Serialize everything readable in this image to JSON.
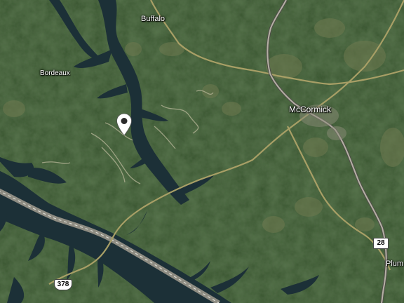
{
  "map": {
    "view": "satellite",
    "places": {
      "buffalo": "Buffalo",
      "bordeaux": "Bordeaux",
      "mccormick": "McCormick",
      "plum": "Plum"
    },
    "route_shields": {
      "us_378": "378",
      "sc_28": "28"
    },
    "marker_icon": "location-pin-icon",
    "colors": {
      "forest": "#2f4a25",
      "water": "#1c3037",
      "highway": "#b4b0a4",
      "road": "#a89f66",
      "label": "#ffffff"
    }
  }
}
